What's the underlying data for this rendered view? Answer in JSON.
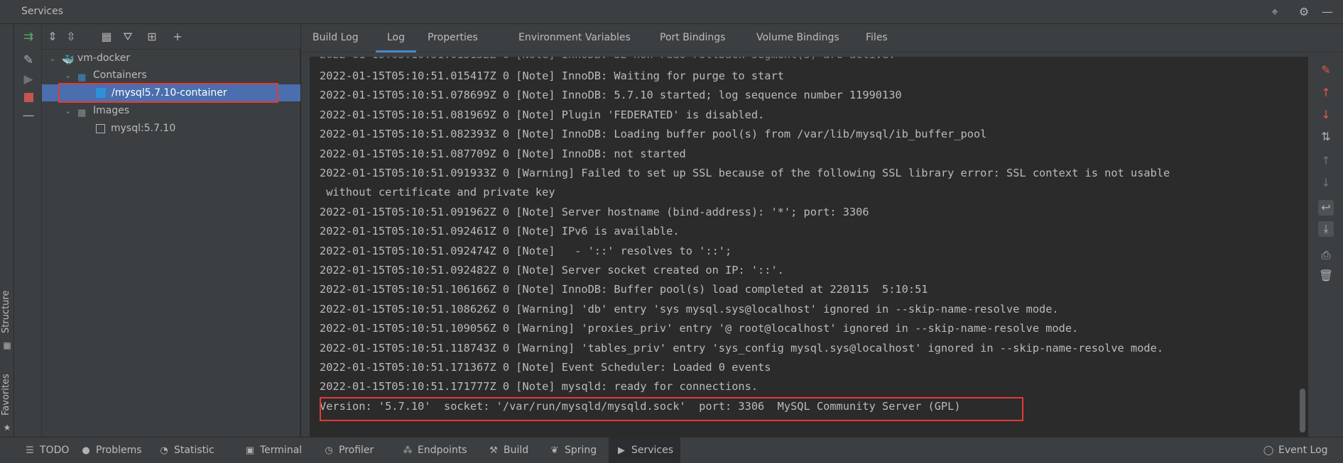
{
  "window": {
    "title": "Services"
  },
  "left_strip": {
    "structure_label": "Structure",
    "favorites_label": "Favorites"
  },
  "tree": {
    "root": "vm-docker",
    "containers_label": "Containers",
    "container_item": "/mysql5.7.10-container",
    "images_label": "Images",
    "image_item": "mysql:5.7.10"
  },
  "tabs": [
    "Build Log",
    "Log",
    "Properties",
    "Environment Variables",
    "Port Bindings",
    "Volume Bindings",
    "Files"
  ],
  "active_tab": "Log",
  "log": {
    "lines": [
      "2022-01-15T05:10:51.015417Z 0 [Note] InnoDB: Waiting for purge to start",
      "2022-01-15T05:10:51.078699Z 0 [Note] InnoDB: 5.7.10 started; log sequence number 11990130",
      "2022-01-15T05:10:51.081969Z 0 [Note] Plugin 'FEDERATED' is disabled.",
      "2022-01-15T05:10:51.082393Z 0 [Note] InnoDB: Loading buffer pool(s) from /var/lib/mysql/ib_buffer_pool",
      "2022-01-15T05:10:51.087709Z 0 [Note] InnoDB: not started",
      "2022-01-15T05:10:51.091933Z 0 [Warning] Failed to set up SSL because of the following SSL library error: SSL context is not usable",
      " without certificate and private key",
      "2022-01-15T05:10:51.091962Z 0 [Note] Server hostname (bind-address): '*'; port: 3306",
      "2022-01-15T05:10:51.092461Z 0 [Note] IPv6 is available.",
      "2022-01-15T05:10:51.092474Z 0 [Note]   - '::' resolves to '::';",
      "2022-01-15T05:10:51.092482Z 0 [Note] Server socket created on IP: '::'.",
      "2022-01-15T05:10:51.106166Z 0 [Note] InnoDB: Buffer pool(s) load completed at 220115  5:10:51",
      "2022-01-15T05:10:51.108626Z 0 [Warning] 'db' entry 'sys mysql.sys@localhost' ignored in --skip-name-resolve mode.",
      "2022-01-15T05:10:51.109056Z 0 [Warning] 'proxies_priv' entry '@ root@localhost' ignored in --skip-name-resolve mode.",
      "2022-01-15T05:10:51.118743Z 0 [Warning] 'tables_priv' entry 'sys_config mysql.sys@localhost' ignored in --skip-name-resolve mode.",
      "2022-01-15T05:10:51.171367Z 0 [Note] Event Scheduler: Loaded 0 events",
      "2022-01-15T05:10:51.171777Z 0 [Note] mysqld: ready for connections.",
      "Version: '5.7.10'  socket: '/var/run/mysqld/mysqld.sock'  port: 3306  MySQL Community Server (GPL)"
    ]
  },
  "bottom": {
    "items": [
      "TODO",
      "Problems",
      "Statistic",
      "Terminal",
      "Profiler",
      "Endpoints",
      "Build",
      "Spring",
      "Services"
    ],
    "event_log": "Event Log"
  },
  "colors": {
    "selection": "#4b6eaf",
    "highlight_box": "#e53935",
    "active_tab_underline": "#4a88c7",
    "docker_blue": "#2496ed"
  }
}
